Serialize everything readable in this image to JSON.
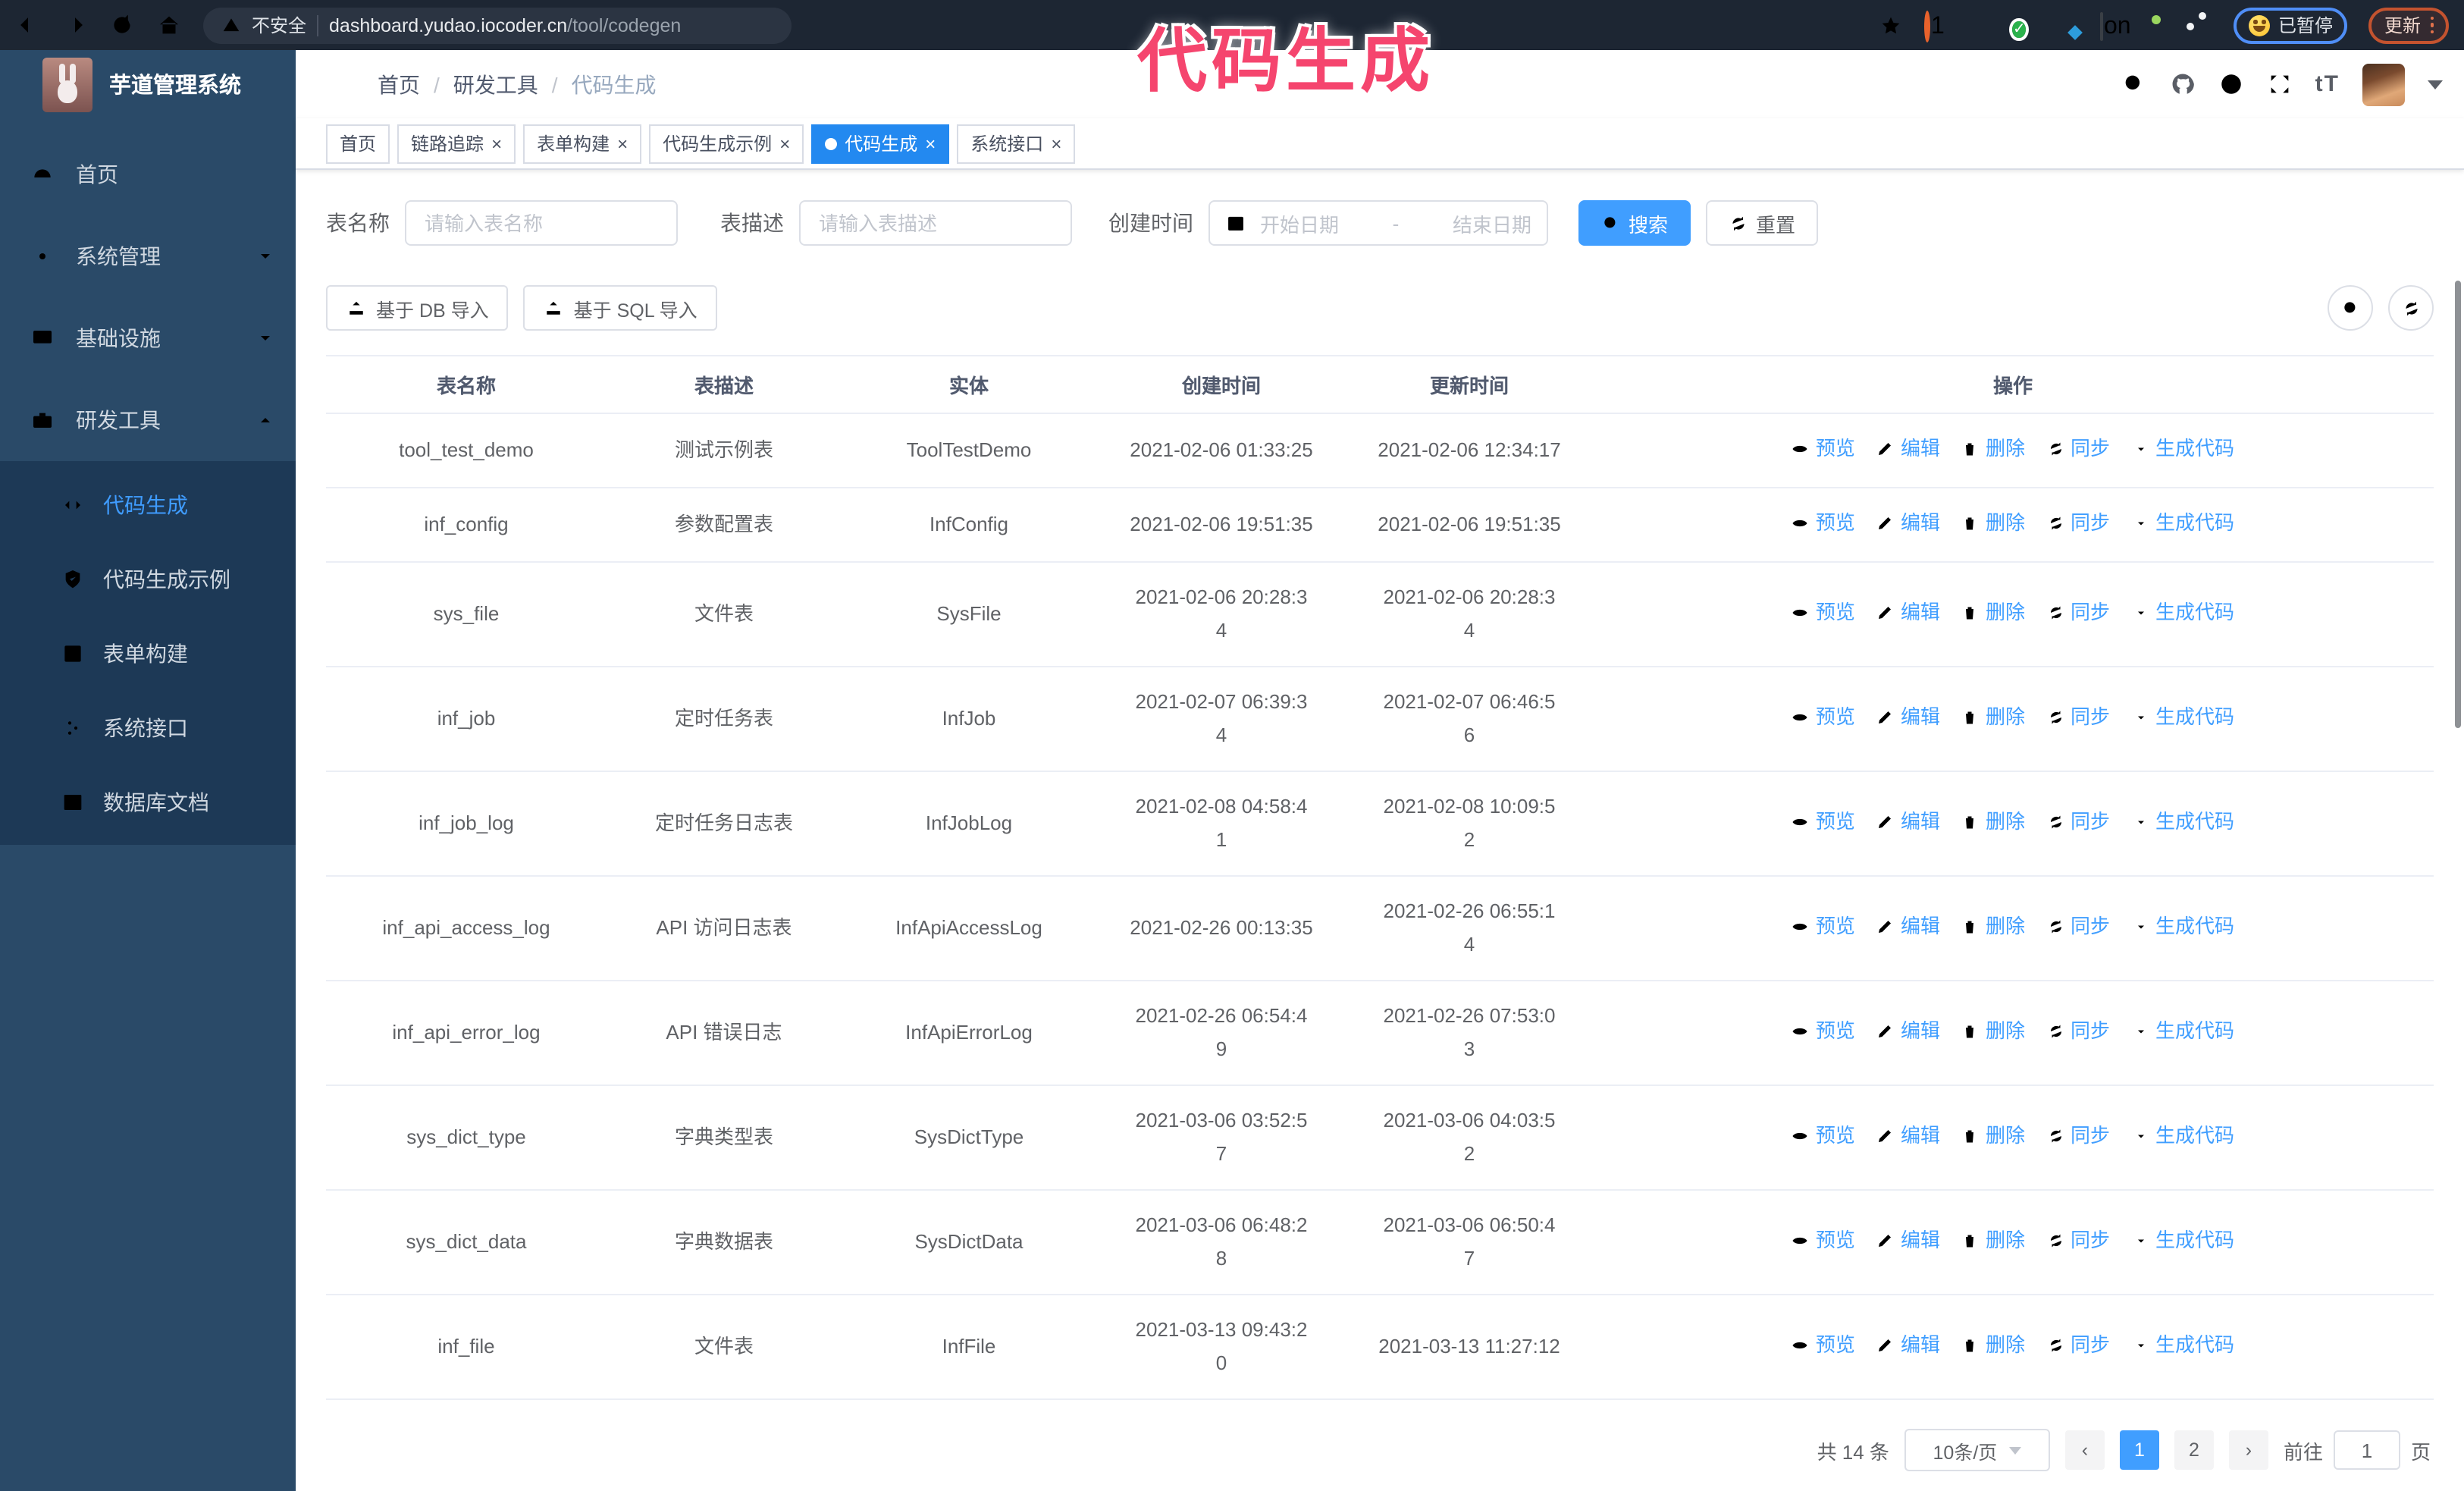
{
  "browser": {
    "security_warning": "不安全",
    "url_host": "dashboard.yudao.iocoder.cn",
    "url_path": "/tool/codegen",
    "paused_badge": "已暂停",
    "update_label": "更新"
  },
  "overlay": {
    "title": "代码生成",
    "color": "#f5456e"
  },
  "sidebar": {
    "app_title": "芋道管理系统",
    "items": [
      {
        "key": "home",
        "label": "首页",
        "icon": "dashboard"
      },
      {
        "key": "system",
        "label": "系统管理",
        "icon": "gear",
        "chevron": "down"
      },
      {
        "key": "infra",
        "label": "基础设施",
        "icon": "monitor",
        "chevron": "down"
      },
      {
        "key": "devtools",
        "label": "研发工具",
        "icon": "toolbox",
        "chevron": "up",
        "expanded": true
      }
    ],
    "submenu": [
      {
        "key": "codegen",
        "label": "代码生成",
        "icon": "code",
        "active": true
      },
      {
        "key": "codegen-example",
        "label": "代码生成示例",
        "icon": "shield"
      },
      {
        "key": "form-builder",
        "label": "表单构建",
        "icon": "form"
      },
      {
        "key": "system-api",
        "label": "系统接口",
        "icon": "api"
      },
      {
        "key": "db-doc",
        "label": "数据库文档",
        "icon": "database"
      }
    ]
  },
  "breadcrumb": [
    "首页",
    "研发工具",
    "代码生成"
  ],
  "breadcrumb_sep": "/",
  "tabs": [
    {
      "key": "home",
      "label": "首页",
      "closable": false,
      "active": false
    },
    {
      "key": "tracing",
      "label": "链路追踪",
      "closable": true,
      "active": false
    },
    {
      "key": "form-builder",
      "label": "表单构建",
      "closable": true,
      "active": false
    },
    {
      "key": "codegen-example",
      "label": "代码生成示例",
      "closable": true,
      "active": false
    },
    {
      "key": "codegen",
      "label": "代码生成",
      "closable": true,
      "active": true
    },
    {
      "key": "system-api",
      "label": "系统接口",
      "closable": true,
      "active": false
    }
  ],
  "filters": {
    "table_name_label": "表名称",
    "table_name_placeholder": "请输入表名称",
    "table_desc_label": "表描述",
    "table_desc_placeholder": "请输入表描述",
    "create_time_label": "创建时间",
    "date_start_placeholder": "开始日期",
    "date_separator": "-",
    "date_end_placeholder": "结束日期",
    "search_button": "搜索",
    "reset_button": "重置"
  },
  "toolbar": {
    "import_db": "基于 DB 导入",
    "import_sql": "基于 SQL 导入"
  },
  "table": {
    "columns": [
      "表名称",
      "表描述",
      "实体",
      "创建时间",
      "更新时间",
      "操作"
    ],
    "actions": [
      {
        "label": "预览",
        "icon": "eye"
      },
      {
        "label": "编辑",
        "icon": "edit"
      },
      {
        "label": "删除",
        "icon": "trash"
      },
      {
        "label": "同步",
        "icon": "sync"
      },
      {
        "label": "生成代码",
        "icon": "download"
      }
    ],
    "rows": [
      {
        "name": "tool_test_demo",
        "desc": "测试示例表",
        "entity": "ToolTestDemo",
        "created": "2021-02-06 01:33:25",
        "updated": "2021-02-06 12:34:17"
      },
      {
        "name": "inf_config",
        "desc": "参数配置表",
        "entity": "InfConfig",
        "created": "2021-02-06 19:51:35",
        "updated": "2021-02-06 19:51:35"
      },
      {
        "name": "sys_file",
        "desc": "文件表",
        "entity": "SysFile",
        "created": "2021-02-06 20:28:3\n4",
        "updated": "2021-02-06 20:28:3\n4"
      },
      {
        "name": "inf_job",
        "desc": "定时任务表",
        "entity": "InfJob",
        "created": "2021-02-07 06:39:3\n4",
        "updated": "2021-02-07 06:46:5\n6"
      },
      {
        "name": "inf_job_log",
        "desc": "定时任务日志表",
        "entity": "InfJobLog",
        "created": "2021-02-08 04:58:4\n1",
        "updated": "2021-02-08 10:09:5\n2"
      },
      {
        "name": "inf_api_access_log",
        "desc": "API 访问日志表",
        "entity": "InfApiAccessLog",
        "created": "2021-02-26 00:13:35",
        "updated": "2021-02-26 06:55:1\n4"
      },
      {
        "name": "inf_api_error_log",
        "desc": "API 错误日志",
        "entity": "InfApiErrorLog",
        "created": "2021-02-26 06:54:4\n9",
        "updated": "2021-02-26 07:53:0\n3"
      },
      {
        "name": "sys_dict_type",
        "desc": "字典类型表",
        "entity": "SysDictType",
        "created": "2021-03-06 03:52:5\n7",
        "updated": "2021-03-06 04:03:5\n2"
      },
      {
        "name": "sys_dict_data",
        "desc": "字典数据表",
        "entity": "SysDictData",
        "created": "2021-03-06 06:48:2\n8",
        "updated": "2021-03-06 06:50:4\n7"
      },
      {
        "name": "inf_file",
        "desc": "文件表",
        "entity": "InfFile",
        "created": "2021-03-13 09:43:2\n0",
        "updated": "2021-03-13 11:27:12"
      }
    ]
  },
  "pagination": {
    "total_text": "共 14 条",
    "page_size": "10条/页",
    "pages": [
      "1",
      "2"
    ],
    "active_page": "1",
    "goto_label": "前往",
    "goto_value": "1",
    "goto_suffix": "页"
  },
  "colors": {
    "accent": "#409eff",
    "active_tab": "#2389f0",
    "sidebar_bg": "#2a4a68",
    "submenu_bg": "#1d3956",
    "browser_bar": "#1d2633",
    "overlay_pink": "#f5456e",
    "update_orange": "#c4532f",
    "paused_blue": "#4f8ef7"
  }
}
